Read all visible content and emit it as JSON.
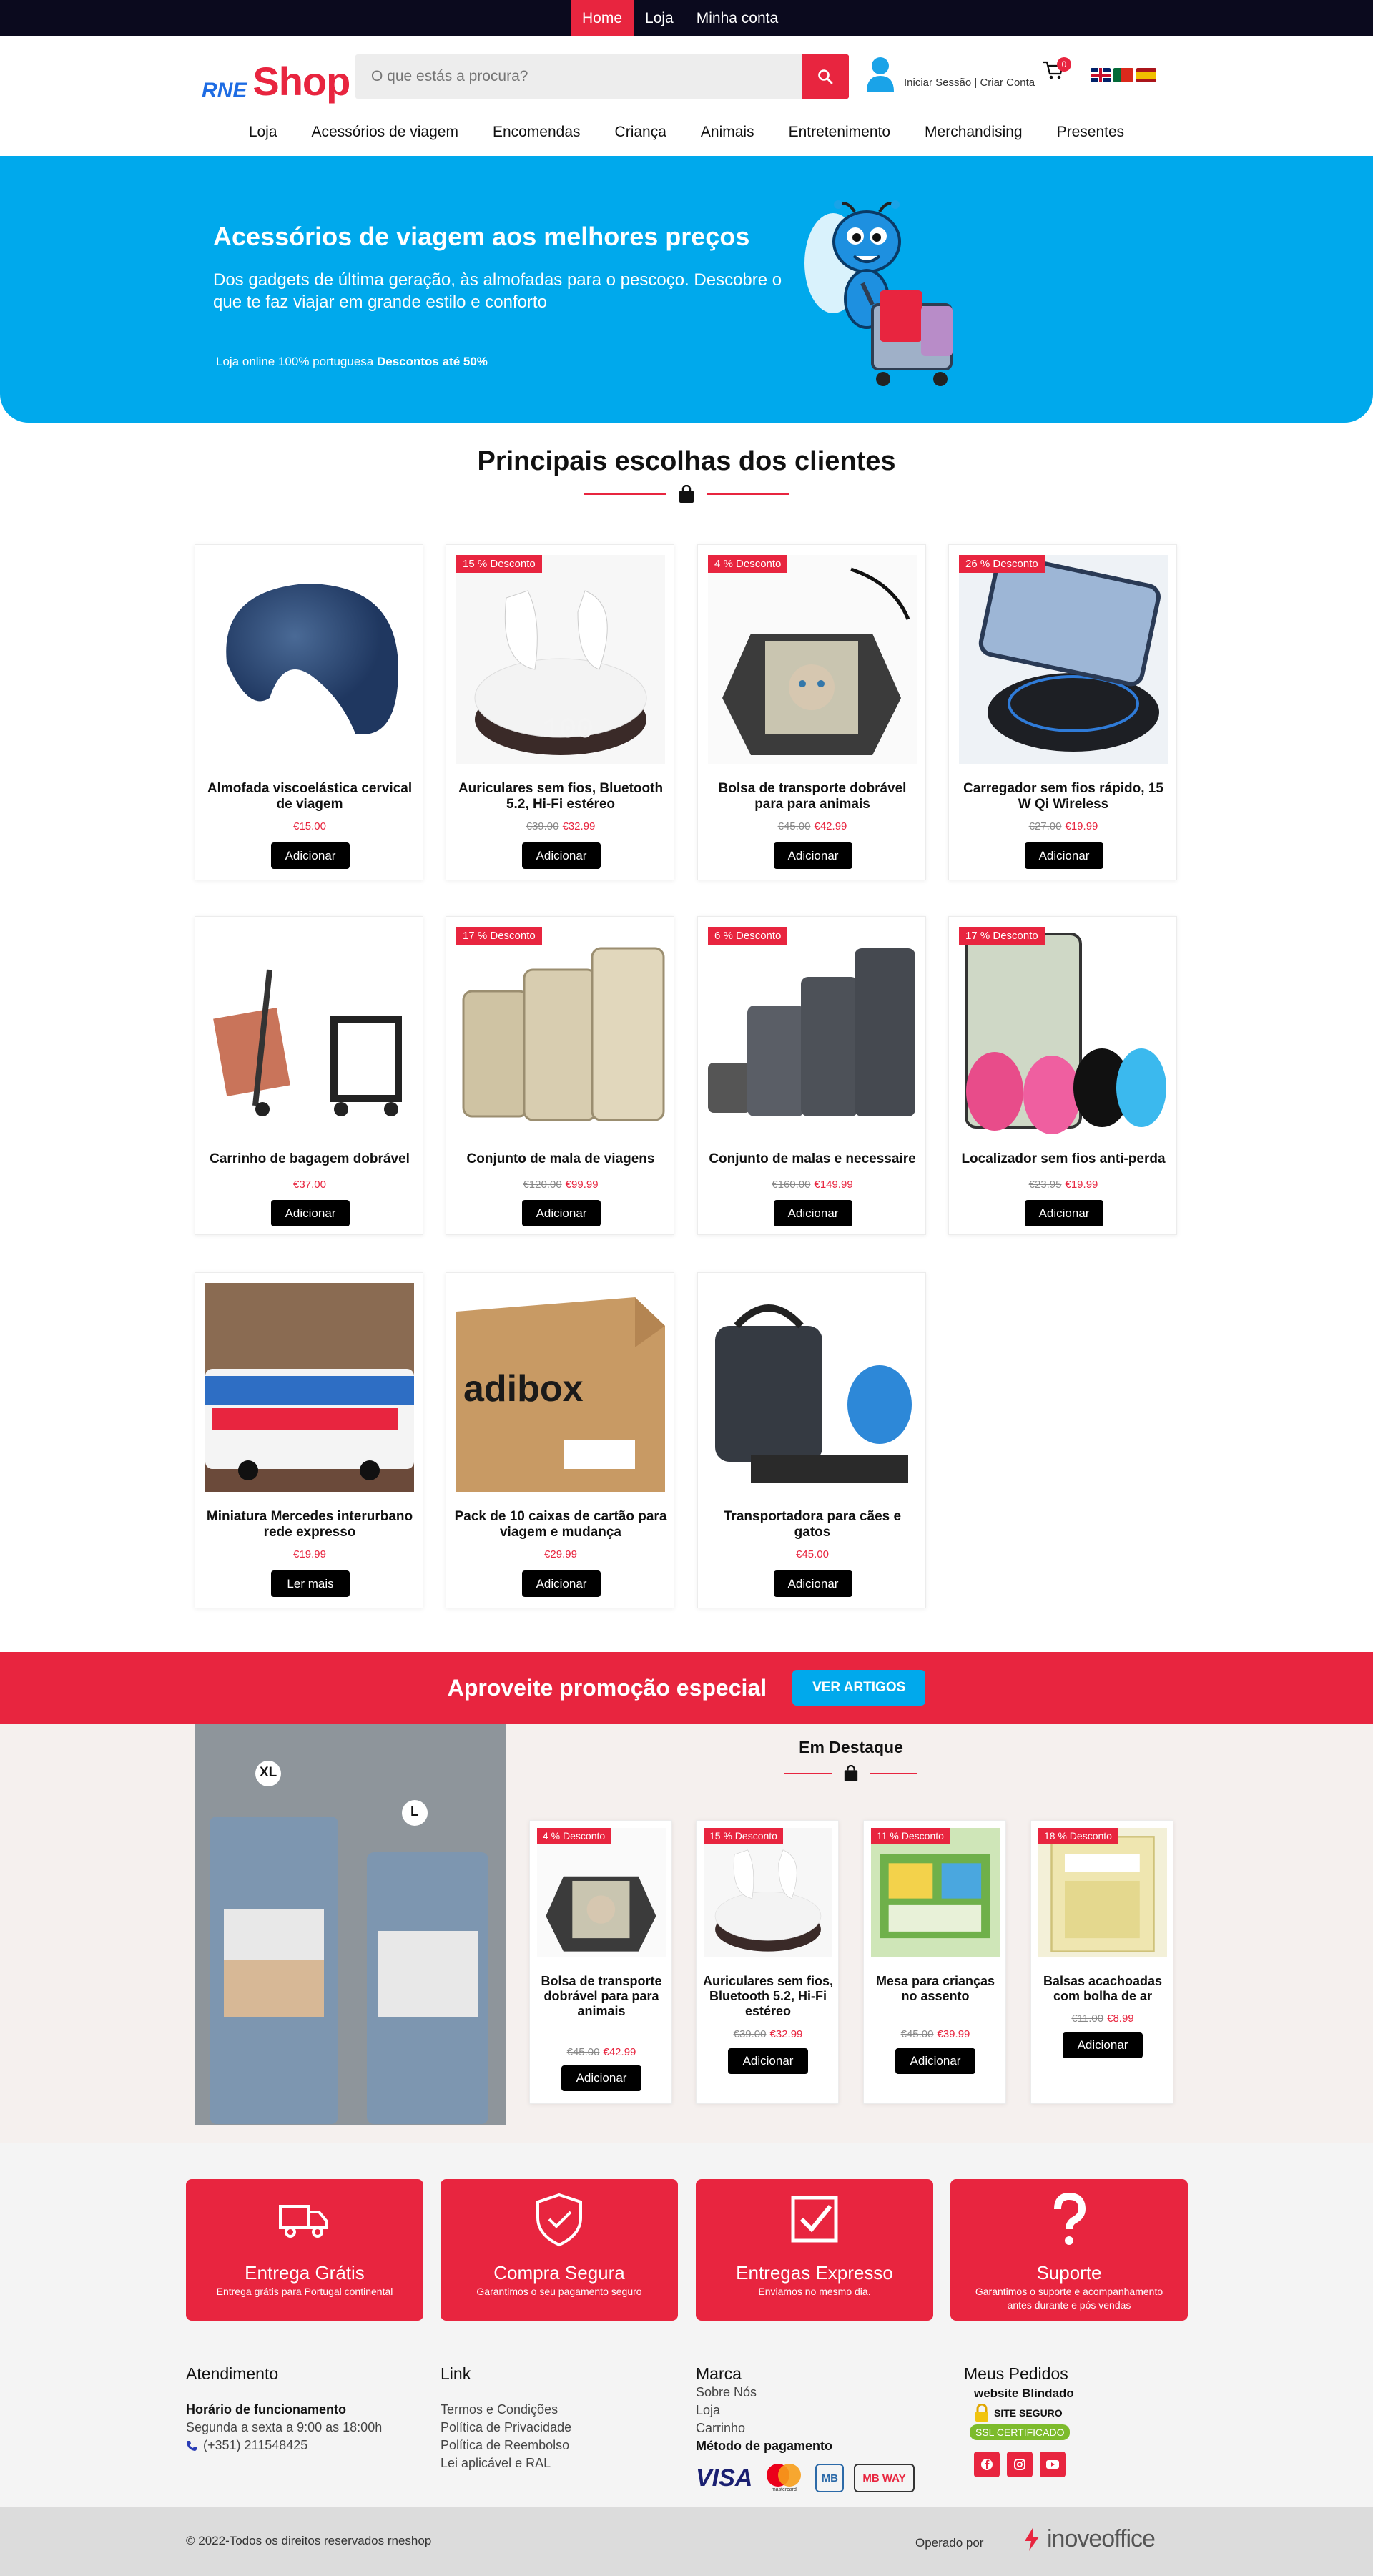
{
  "topnav": {
    "items": [
      "Home",
      "Loja",
      "Minha conta"
    ]
  },
  "header": {
    "logo_prefix": "RNE",
    "logo_main": "Shop",
    "search_placeholder": "O que estás a procura?",
    "user_label": "Iniciar Sessão | Criar Conta",
    "cart_count": "0",
    "flags": [
      "en",
      "pt",
      "es"
    ]
  },
  "mainnav": {
    "items": [
      "Loja",
      "Acessórios de viagem",
      "Encomendas",
      "Criança",
      "Animais",
      "Entretenimento",
      "Merchandising",
      "Presentes"
    ]
  },
  "hero": {
    "title": "Acessórios de viagem aos melhores preços",
    "subtitle": "Dos gadgets de última geração, às almofadas para o pescoço. Descobre o que te faz viajar em grande estilo e conforto",
    "small_text": "Loja online 100% portuguesa",
    "small_bold": "Descontos até 50%"
  },
  "top_picks": {
    "title": "Principais escolhas dos clientes",
    "products": [
      {
        "title": "Almofada viscoelástica cervical de viagem",
        "old_price": "",
        "price": "€15.00",
        "badge": "",
        "button": "Adicionar",
        "image": "neck-pillow"
      },
      {
        "title": "Auriculares sem fios, Bluetooth 5.2, Hi-Fi estéreo",
        "old_price": "€39.00",
        "price": "€32.99",
        "badge": "15 % Desconto",
        "button": "Adicionar",
        "image": "earbuds"
      },
      {
        "title": "Bolsa de transporte dobrável para para animais",
        "old_price": "€45.00",
        "price": "€42.99",
        "badge": "4 % Desconto",
        "button": "Adicionar",
        "image": "pet-bag"
      },
      {
        "title": "Carregador sem fios rápido, 15 W Qi Wireless",
        "old_price": "€27.00",
        "price": "€19.99",
        "badge": "26 % Desconto",
        "button": "Adicionar",
        "image": "wireless-charger"
      },
      {
        "title": "Carrinho de bagagem dobrável",
        "old_price": "",
        "price": "€37.00",
        "badge": "",
        "button": "Adicionar",
        "image": "luggage-cart"
      },
      {
        "title": "Conjunto de mala de viagens",
        "old_price": "€120.00",
        "price": "€99.99",
        "badge": "17 % Desconto",
        "button": "Adicionar",
        "image": "gold-suitcases"
      },
      {
        "title": "Conjunto de malas e necessaire",
        "old_price": "€160.00",
        "price": "€149.99",
        "badge": "6 % Desconto",
        "button": "Adicionar",
        "image": "grey-suitcases"
      },
      {
        "title": "Localizador sem fios anti-perda",
        "old_price": "€23.95",
        "price": "€19.99",
        "badge": "17 % Desconto",
        "button": "Adicionar",
        "image": "trackers"
      },
      {
        "title": "Miniatura Mercedes interurbano rede expresso",
        "old_price": "",
        "price": "€19.99",
        "badge": "",
        "button": "Ler mais",
        "image": "bus-model"
      },
      {
        "title": "Pack de 10 caixas de cartão para viagem e mudança",
        "old_price": "",
        "price": "€29.99",
        "badge": "",
        "button": "Adicionar",
        "image": "boxes"
      },
      {
        "title": "Transportadora para cães e gatos",
        "old_price": "",
        "price": "€45.00",
        "badge": "",
        "button": "Adicionar",
        "image": "pet-carrier"
      }
    ],
    "box_brand": "adibox"
  },
  "promo": {
    "text": "Aproveite promoção especial",
    "button": "VER ARTIGOS"
  },
  "featured": {
    "title": "Em Destaque",
    "size_labels": [
      "XL",
      "L"
    ],
    "products": [
      {
        "title": "Bolsa de transporte dobrável para para animais",
        "old_price": "€45.00",
        "price": "€42.99",
        "badge": "4 % Desconto",
        "button": "Adicionar",
        "image": "pet-bag"
      },
      {
        "title": "Auriculares sem fios, Bluetooth 5.2, Hi-Fi estéreo",
        "old_price": "€39.00",
        "price": "€32.99",
        "badge": "15 % Desconto",
        "button": "Adicionar",
        "image": "earbuds"
      },
      {
        "title": "Mesa para crianças no assento",
        "old_price": "€45.00",
        "price": "€39.99",
        "badge": "11 % Desconto",
        "button": "Adicionar",
        "image": "kids-tray"
      },
      {
        "title": "Balsas acachoadas com bolha de ar",
        "old_price": "€11.00",
        "price": "€8.99",
        "badge": "18 % Desconto",
        "button": "Adicionar",
        "image": "bubble-bags"
      }
    ]
  },
  "features": [
    {
      "title": "Entrega Grátis",
      "desc": "Entrega grátis para Portugal continental",
      "icon": "truck-icon"
    },
    {
      "title": "Compra Segura",
      "desc": "Garantimos o seu pagamento seguro",
      "icon": "shield-icon"
    },
    {
      "title": "Entregas Expresso",
      "desc": "Enviamos no mesmo dia.",
      "icon": "checkbox-icon"
    },
    {
      "title": "Suporte",
      "desc": "Garantimos o suporte e acompanhamento antes durante e pós vendas",
      "icon": "question-icon"
    }
  ],
  "footer": {
    "atendimento": {
      "title": "Atendimento",
      "hours_title": "Horário de funcionamento",
      "hours": "Segunda a sexta a 9:00 as 18:00h",
      "phone": "(+351) 211548425"
    },
    "link": {
      "title": "Link",
      "items": [
        "Termos e Condições",
        "Política de Privacidade",
        "Política de Reembolso",
        "Lei aplicável e RAL"
      ]
    },
    "marca": {
      "title": "Marca",
      "items": [
        "Sobre Nós",
        "Loja",
        "Carrinho"
      ],
      "payment_title": "Método de pagamento",
      "payments": [
        "VISA",
        "mastercard",
        "MB",
        "MB WAY"
      ]
    },
    "pedidos": {
      "title": "Meus Pedidos",
      "blindado": "website Blindado",
      "site_seguro": "SITE SEGURO",
      "ssl": "SSL CERTIFICADO",
      "social": [
        "facebook-icon",
        "instagram-icon",
        "youtube-icon"
      ]
    },
    "copyright": "© 2022-Todos os direitos reservados rneshop",
    "operated_by": "Operado por",
    "operator": "inoveoffice"
  },
  "colors": {
    "accent": "#e8253f",
    "hero": "#00a9ec",
    "topbar": "#0b0a1e"
  }
}
